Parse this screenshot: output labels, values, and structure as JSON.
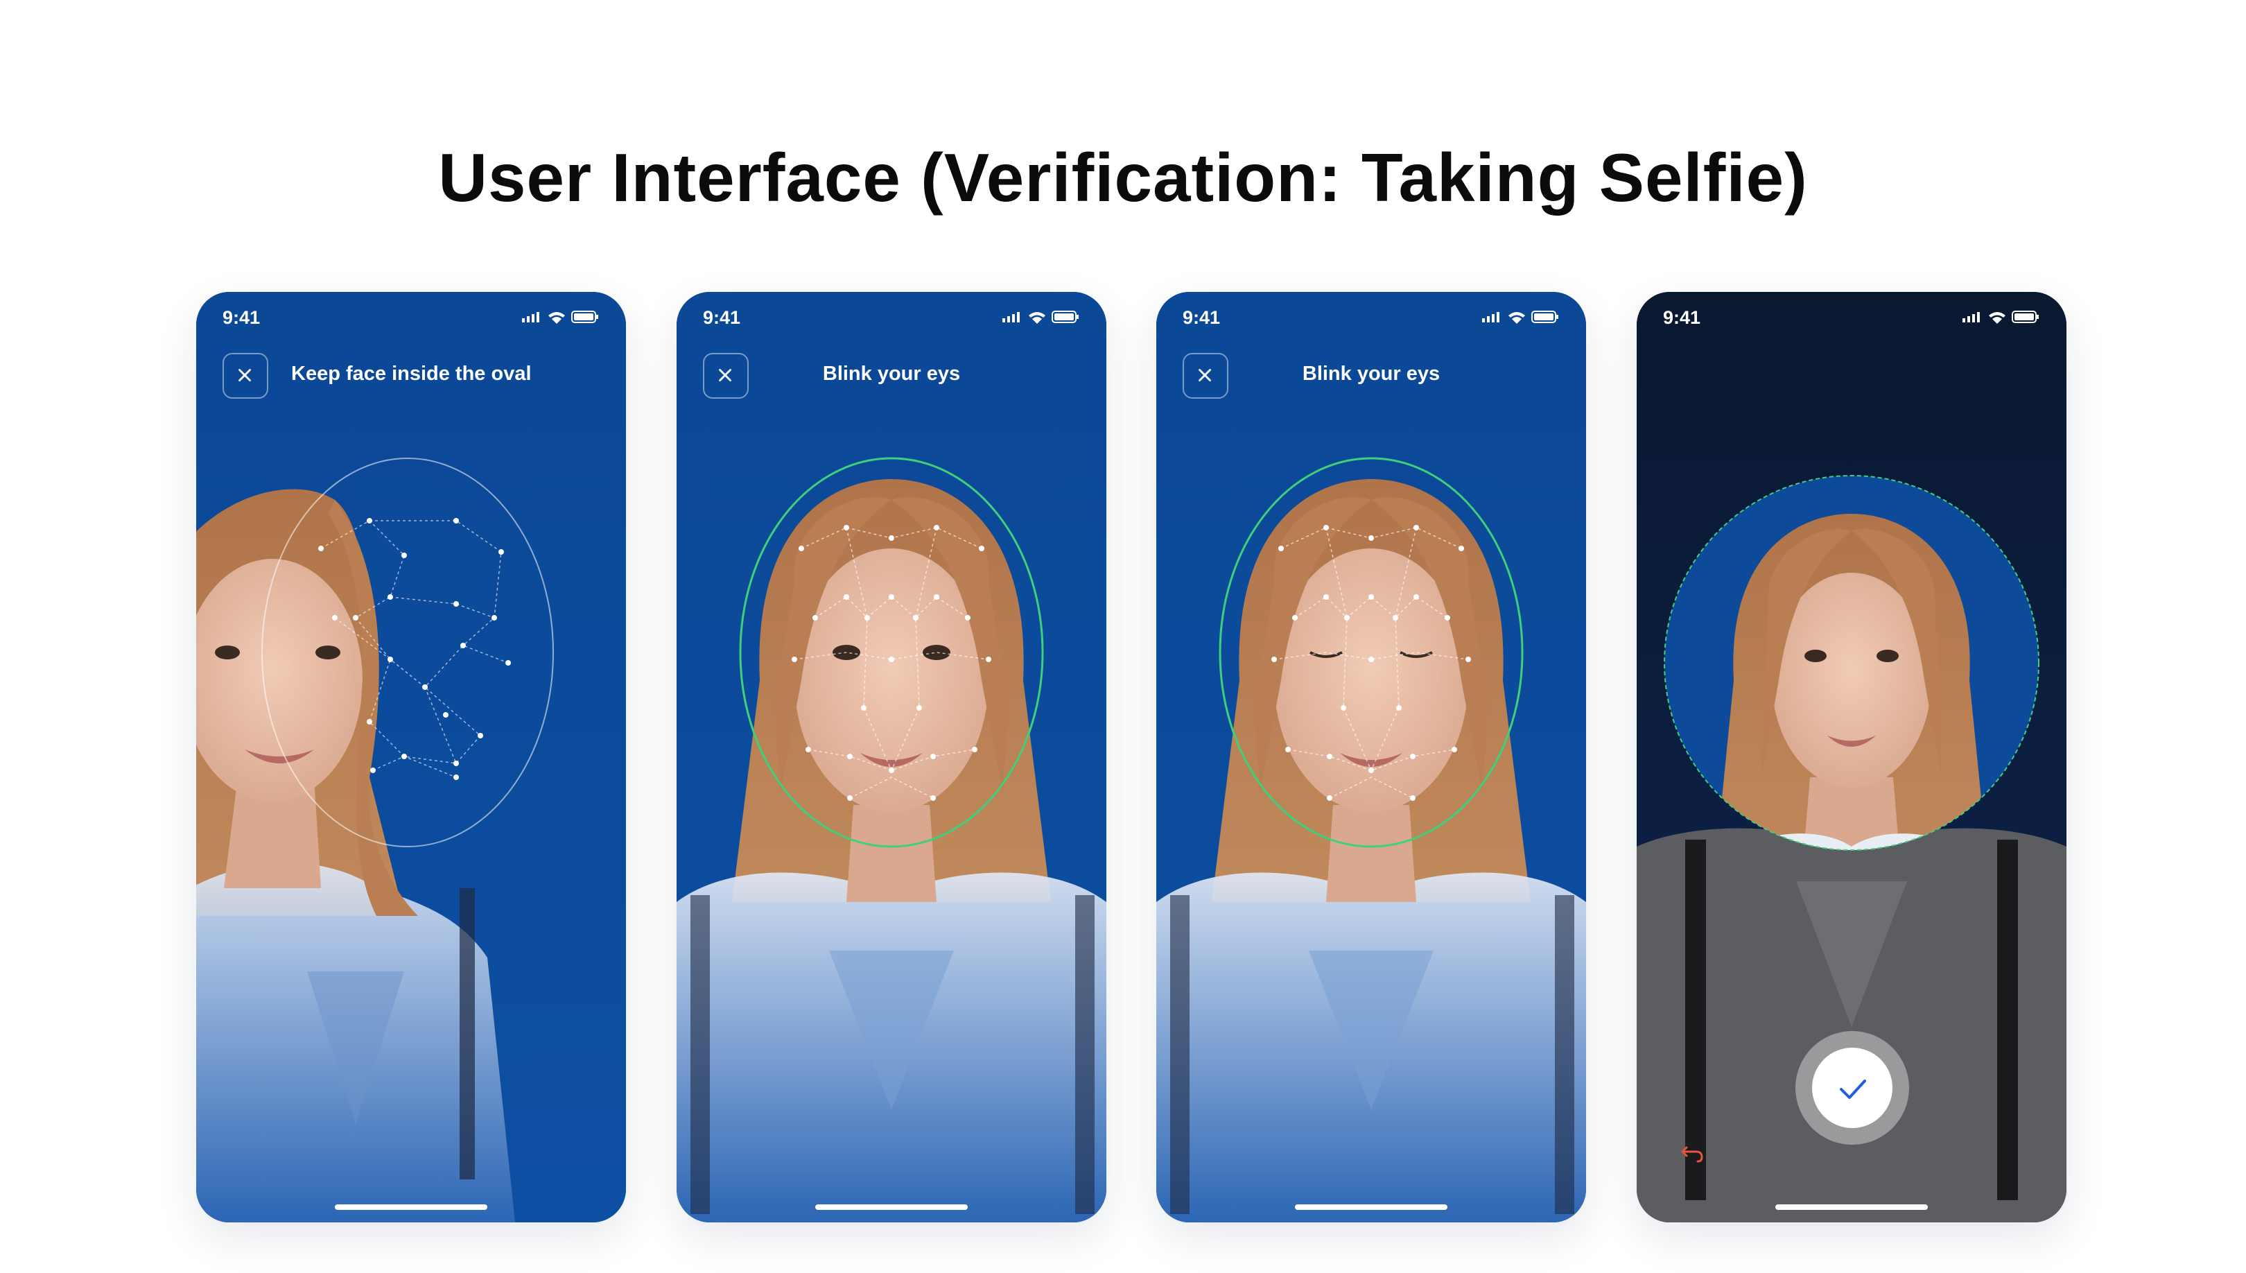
{
  "page": {
    "title": "User Interface (Verification: Taking Selfie)"
  },
  "screens": [
    {
      "status_time": "9:41",
      "prompt": "Keep face inside the oval",
      "close_icon": "close-icon",
      "overlay": "face-mesh-offset"
    },
    {
      "status_time": "9:41",
      "prompt": "Blink your eys",
      "close_icon": "close-icon",
      "overlay": "face-mesh-aligned"
    },
    {
      "status_time": "9:41",
      "prompt": "Blink your eys",
      "close_icon": "close-icon",
      "overlay": "face-mesh-eyes-closed"
    },
    {
      "status_time": "9:41",
      "overlay": "captured-photo-circle",
      "capture_icon": "checkmark-icon",
      "retake_icon": "undo-arrow-icon"
    }
  ],
  "colors": {
    "brand_blue": "#0a4a99",
    "dark_bg": "#0b1a36",
    "oval_ok": "#3fd07c",
    "capture_check": "#1f5fe0",
    "retake_accent": "#e5553d"
  }
}
